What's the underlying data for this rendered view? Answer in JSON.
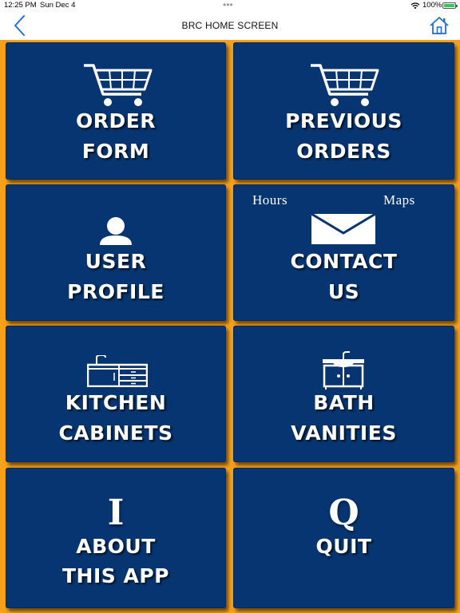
{
  "status_bar": {
    "time": "12:25 PM",
    "date": "Sun Dec 4",
    "battery": "100%"
  },
  "nav": {
    "title": "BRC HOME SCREEN"
  },
  "tiles": {
    "order_form": {
      "line1": "ORDER",
      "line2": "FORM"
    },
    "previous_orders": {
      "line1": "PREVIOUS",
      "line2": "ORDERS"
    },
    "user_profile": {
      "line1": "USER",
      "line2": "PROFILE"
    },
    "contact_us": {
      "line1": "CONTACT",
      "line2": "US",
      "hours": "Hours",
      "maps": "Maps"
    },
    "kitchen_cabinets": {
      "line1": "KITCHEN",
      "line2": "CABINETS"
    },
    "bath_vanities": {
      "line1": "BATH",
      "line2": "VANITIES"
    },
    "about": {
      "letter": "I",
      "line1": "ABOUT",
      "line2": "THIS APP"
    },
    "quit": {
      "letter": "Q",
      "line1": "QUIT"
    }
  },
  "colors": {
    "tile": "#073571",
    "background": "#f7a11b",
    "accent": "#1f6fd6"
  },
  "icons": [
    "back-chevron-icon",
    "home-icon",
    "shopping-cart-icon",
    "user-icon",
    "envelope-icon",
    "kitchen-cabinet-icon",
    "bath-vanity-icon",
    "wifi-icon",
    "battery-icon"
  ]
}
